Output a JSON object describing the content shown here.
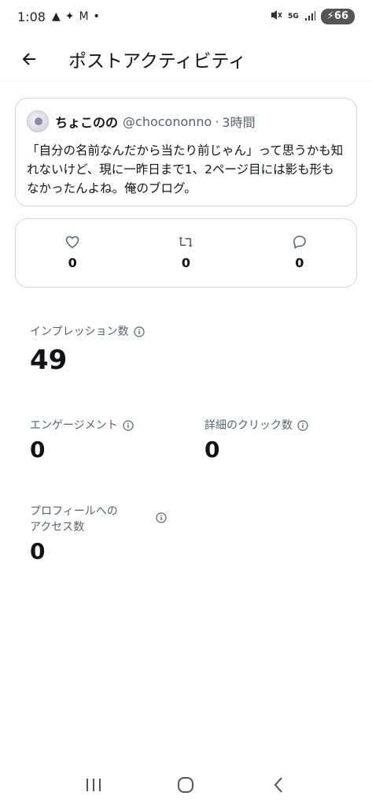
{
  "status_bar": {
    "time": "1:08",
    "icons_left": [
      "alert-icon",
      "butterfly-icon",
      "gmail-icon",
      "dot"
    ],
    "network": "5G",
    "battery": "66"
  },
  "header": {
    "title": "ポストアクティビティ"
  },
  "tweet": {
    "name": "ちょこのの",
    "handle": "@chocononno",
    "separator": "·",
    "time": "3時間",
    "text": "「自分の名前なんだから当たり前じゃん」って思うかも知れないけど、現に一昨日まで1、2ページ目には影も形もなかったんよね。俺のブログ。"
  },
  "engagement": {
    "likes": "0",
    "reposts": "0",
    "replies": "0"
  },
  "metrics": {
    "impressions": {
      "label": "インプレッション数",
      "value": "49"
    },
    "engagements": {
      "label": "エンゲージメント",
      "value": "0"
    },
    "detail_clicks": {
      "label": "詳細のクリック数",
      "value": "0"
    },
    "profile_visits": {
      "label": "プロフィールへのアクセス数",
      "value": "0"
    }
  },
  "colors": {
    "text_primary": "#0f1419",
    "text_secondary": "#536471",
    "border": "#cfd9de"
  }
}
